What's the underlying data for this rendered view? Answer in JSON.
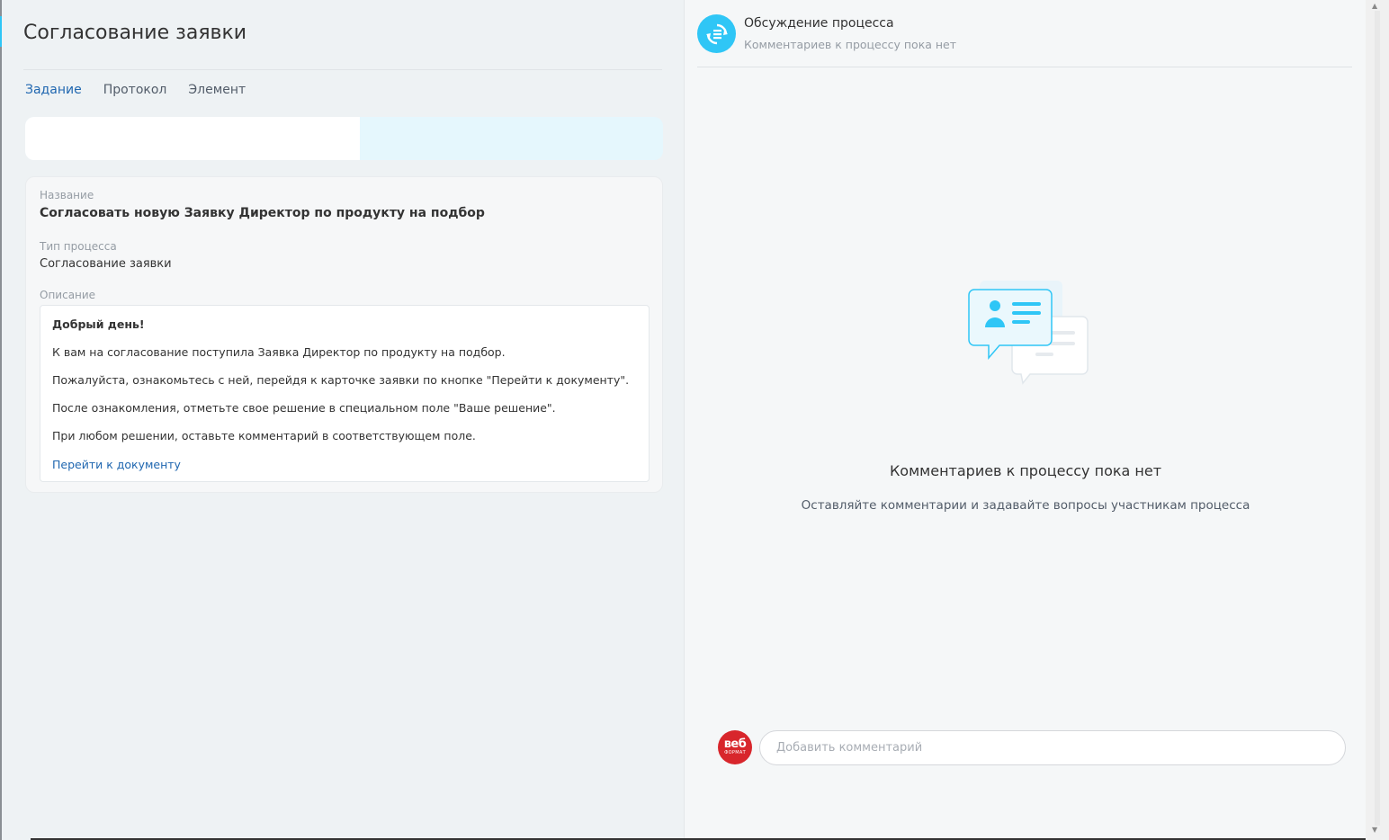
{
  "left": {
    "page_title": "Согласование заявки",
    "tabs": [
      {
        "label": "Задание",
        "active": true
      },
      {
        "label": "Протокол",
        "active": false
      },
      {
        "label": "Элемент",
        "active": false
      }
    ],
    "progress_fraction": 0.525,
    "card": {
      "name_label": "Название",
      "name_value": "Согласовать новую Заявку Директор по продукту на подбор",
      "type_label": "Тип процесса",
      "type_value": "Согласование заявки",
      "desc_label": "Описание",
      "desc_lines": [
        "Добрый день!",
        "К вам на согласование поступила Заявка Директор по продукту на подбор.",
        "Пожалуйста, ознакомьтесь с ней, перейдя к карточке заявки по кнопке \"Перейти к документу\".",
        "После ознакомления, отметьте свое решение в специальном поле \"Ваше решение\".",
        "При любом решении, оставьте комментарий в соответствующем поле."
      ],
      "desc_link": "Перейти к документу"
    }
  },
  "right": {
    "chat_title": "Обсуждение процесса",
    "chat_subtitle": "Комментариев к процессу пока нет",
    "empty_title": "Комментариев к процессу пока нет",
    "empty_text": "Оставляйте комментарии и задавайте вопросы участникам процесса",
    "avatar_text_big": "веб",
    "avatar_text_small": "ФОРМАТ",
    "comment_placeholder": "Добавить комментарий"
  },
  "colors": {
    "accent": "#2fc6f6",
    "link": "#2067b0",
    "avatar_brand": "#d8262c"
  },
  "icons": {
    "chat_avatar": "process-discussion-icon",
    "illustration": "chat-bubbles-icon"
  }
}
